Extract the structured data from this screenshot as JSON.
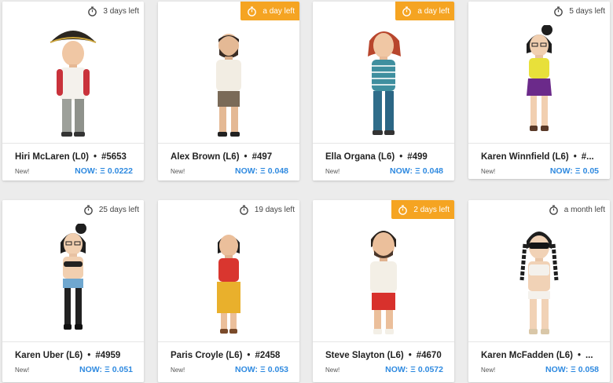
{
  "ui": {
    "new_label": "New!",
    "price_prefix": "NOW:",
    "eth_symbol": "Ξ",
    "separator": "•"
  },
  "colors": {
    "urgent_badge": "#f5a422",
    "price": "#2f8ae0",
    "background": "#ececec",
    "card": "#ffffff"
  },
  "cards": [
    {
      "name": "Hiri McLaren (L0)",
      "id": "#5653",
      "price": "0.0222",
      "timer": "3 days left",
      "urgent": false,
      "avatar": "pirate-hat"
    },
    {
      "name": "Alex Brown (L6)",
      "id": "#497",
      "price": "0.048",
      "timer": "a day left",
      "urgent": true,
      "avatar": "bearded-man"
    },
    {
      "name": "Ella Organa (L6)",
      "id": "#499",
      "price": "0.048",
      "timer": "a day left",
      "urgent": true,
      "avatar": "red-hair-woman"
    },
    {
      "name": "Karen Winnfield (L6)",
      "id": "#...",
      "price": "0.05",
      "timer": "5 days left",
      "urgent": false,
      "avatar": "bun-glasses-purple"
    },
    {
      "name": "Karen Uber (L6)",
      "id": "#4959",
      "price": "0.051",
      "timer": "25 days left",
      "urgent": false,
      "avatar": "bun-glasses-bikini"
    },
    {
      "name": "Paris Croyle (L6)",
      "id": "#2458",
      "price": "0.053",
      "timer": "19 days left",
      "urgent": false,
      "avatar": "red-top-woman"
    },
    {
      "name": "Steve Slayton (L6)",
      "id": "#4670",
      "price": "0.0572",
      "timer": "2 days left",
      "urgent": true,
      "avatar": "curly-man"
    },
    {
      "name": "Karen McFadden (L6)",
      "id": "...",
      "price": "0.058",
      "timer": "a month left",
      "urgent": false,
      "avatar": "masked-braids"
    }
  ]
}
